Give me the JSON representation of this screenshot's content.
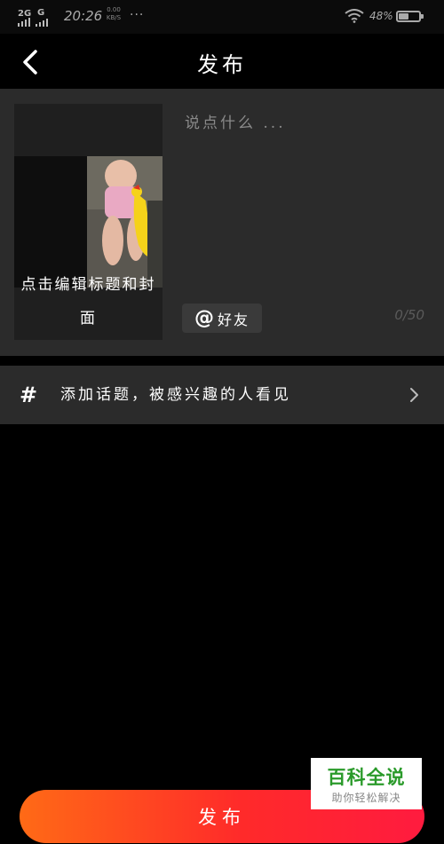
{
  "status_bar": {
    "signal": "2G",
    "signal2": "G",
    "time": "20:26",
    "speed_value": "0.00",
    "speed_unit": "KB/S",
    "dots": "···",
    "battery": "48%"
  },
  "header": {
    "title": "发布",
    "back_icon": "chevron-left-icon"
  },
  "compose": {
    "cover_label": "点击编辑标题和封面",
    "caption_placeholder": "说点什么 ...",
    "caption_value": "",
    "mention_symbol": "@",
    "mention_label": "好友",
    "char_count": "0/50"
  },
  "topic": {
    "icon": "#",
    "label": "添加话题，被感兴趣的人看见",
    "chevron_icon": "chevron-right-icon"
  },
  "publish": {
    "label": "发布"
  },
  "watermark": {
    "main": "百科全说",
    "sub": "助你轻松解决"
  },
  "colors": {
    "background": "#000000",
    "card": "#2b2b2b",
    "publish_gradient_start": "#ff6a16",
    "publish_gradient_end": "#ff1b3f",
    "watermark_green": "#2a9a2a"
  }
}
